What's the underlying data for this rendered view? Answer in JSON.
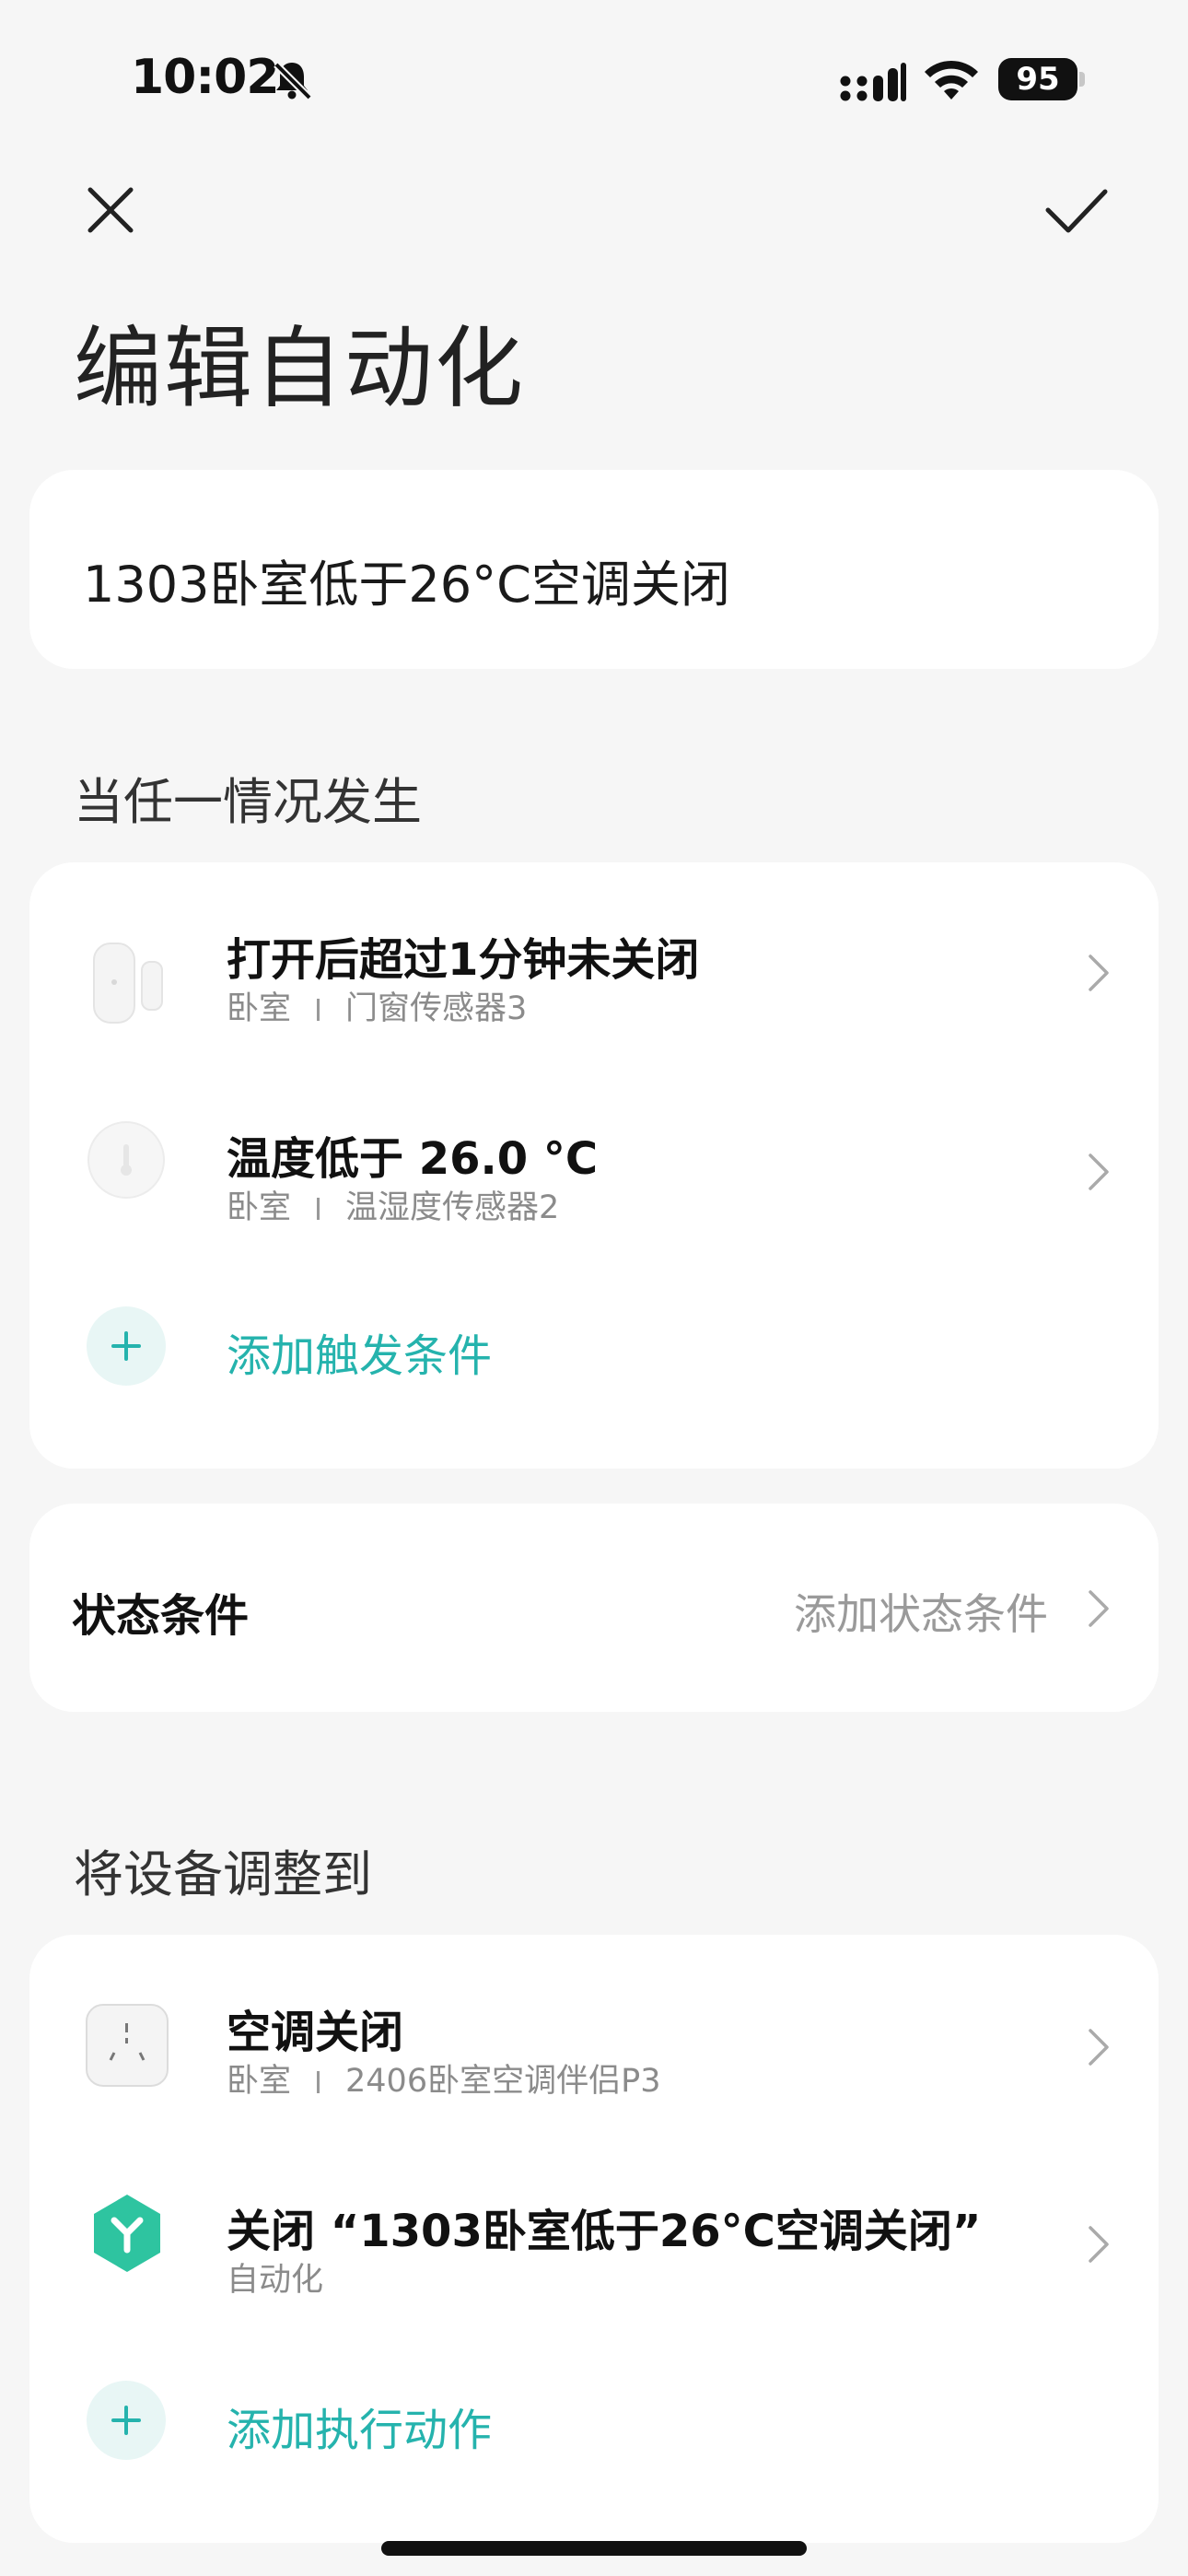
{
  "status_bar": {
    "time": "10:02",
    "battery": "95"
  },
  "header": {
    "title": "编辑自动化"
  },
  "automation_name": "1303卧室低于26°C空调关闭",
  "trigger_section": {
    "label": "当任一情况发生",
    "items": [
      {
        "title": "打开后超过1分钟未关闭",
        "room": "卧室",
        "device": "门窗传感器3",
        "icon": "door-window-sensor-icon"
      },
      {
        "title": "温度低于 26.0 °C",
        "room": "卧室",
        "device": "温湿度传感器2",
        "icon": "temperature-humidity-sensor-icon"
      }
    ],
    "add_label": "添加触发条件"
  },
  "state_condition": {
    "label": "状态条件",
    "hint": "添加状态条件"
  },
  "action_section": {
    "label": "将设备调整到",
    "items": [
      {
        "title": "空调关闭",
        "room": "卧室",
        "device": "2406卧室空调伴侣P3",
        "icon": "ac-companion-icon"
      },
      {
        "title": "关闭 “1303卧室低于26°C空调关闭”",
        "subtitle": "自动化",
        "icon": "automation-icon"
      }
    ],
    "add_label": "添加执行动作"
  },
  "colors": {
    "accent": "#25b3ad",
    "background": "#f6f6f6",
    "card": "#ffffff",
    "automation_icon": "#2ec4a0"
  }
}
